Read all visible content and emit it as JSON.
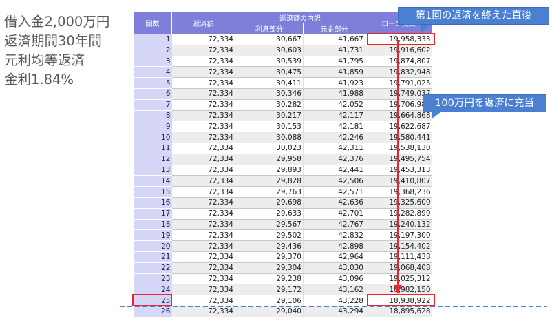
{
  "loan_info": [
    "借入金2,000万円",
    "返済期間30年間",
    "元利均等返済",
    "金利1.84%"
  ],
  "table": {
    "headers": {
      "count": "回数",
      "payment": "返済額",
      "breakdown": "返済額の内訳",
      "interest": "利息部分",
      "principal": "元金部分",
      "balance": "ローン残高"
    },
    "rows": [
      [
        "1",
        "72,334",
        "30,667",
        "41,667",
        "19,958,333"
      ],
      [
        "2",
        "72,334",
        "30,603",
        "41,731",
        "19,916,602"
      ],
      [
        "3",
        "72,334",
        "30,539",
        "41,795",
        "19,874,807"
      ],
      [
        "4",
        "72,334",
        "30,475",
        "41,859",
        "19,832,948"
      ],
      [
        "5",
        "72,334",
        "30,411",
        "41,923",
        "19,791,025"
      ],
      [
        "6",
        "72,334",
        "30,346",
        "41,988",
        "19,749,037"
      ],
      [
        "7",
        "72,334",
        "30,282",
        "42,052",
        "19,706,985"
      ],
      [
        "8",
        "72,334",
        "30,217",
        "42,117",
        "19,664,868"
      ],
      [
        "9",
        "72,334",
        "30,153",
        "42,181",
        "19,622,687"
      ],
      [
        "10",
        "72,334",
        "30,088",
        "42,246",
        "19,580,441"
      ],
      [
        "11",
        "72,334",
        "30,023",
        "42,311",
        "19,538,130"
      ],
      [
        "12",
        "72,334",
        "29,958",
        "42,376",
        "19,495,754"
      ],
      [
        "13",
        "72,334",
        "29,893",
        "42,441",
        "19,453,313"
      ],
      [
        "14",
        "72,334",
        "29,828",
        "42,506",
        "19,410,807"
      ],
      [
        "15",
        "72,334",
        "29,763",
        "42,571",
        "19,368,236"
      ],
      [
        "16",
        "72,334",
        "29,698",
        "42,636",
        "19,325,600"
      ],
      [
        "17",
        "72,334",
        "29,633",
        "42,701",
        "19,282,899"
      ],
      [
        "18",
        "72,334",
        "29,567",
        "42,767",
        "19,240,132"
      ],
      [
        "19",
        "72,334",
        "29,502",
        "42,832",
        "19,197,300"
      ],
      [
        "20",
        "72,334",
        "29,436",
        "42,898",
        "19,154,402"
      ],
      [
        "21",
        "72,334",
        "29,370",
        "42,964",
        "19,111,438"
      ],
      [
        "22",
        "72,334",
        "29,304",
        "43,030",
        "19,068,408"
      ],
      [
        "23",
        "72,334",
        "29,238",
        "43,096",
        "19,025,312"
      ],
      [
        "24",
        "72,334",
        "29,172",
        "43,162",
        "18,982,150"
      ],
      [
        "25",
        "72,334",
        "29,106",
        "43,228",
        "18,938,922"
      ],
      [
        "26",
        "72,334",
        "29,040",
        "43,294",
        "18,895,628"
      ]
    ]
  },
  "callouts": {
    "first_payment": "第1回の返済を終えた直後",
    "prepayment": "100万円を返済に充当"
  },
  "colors": {
    "header": "#7f7fdb",
    "count_cell": "#d6d6f7",
    "callout": "#4a7fd1",
    "highlight": "#e8262b",
    "dashed_line": "#4a7fd1"
  }
}
